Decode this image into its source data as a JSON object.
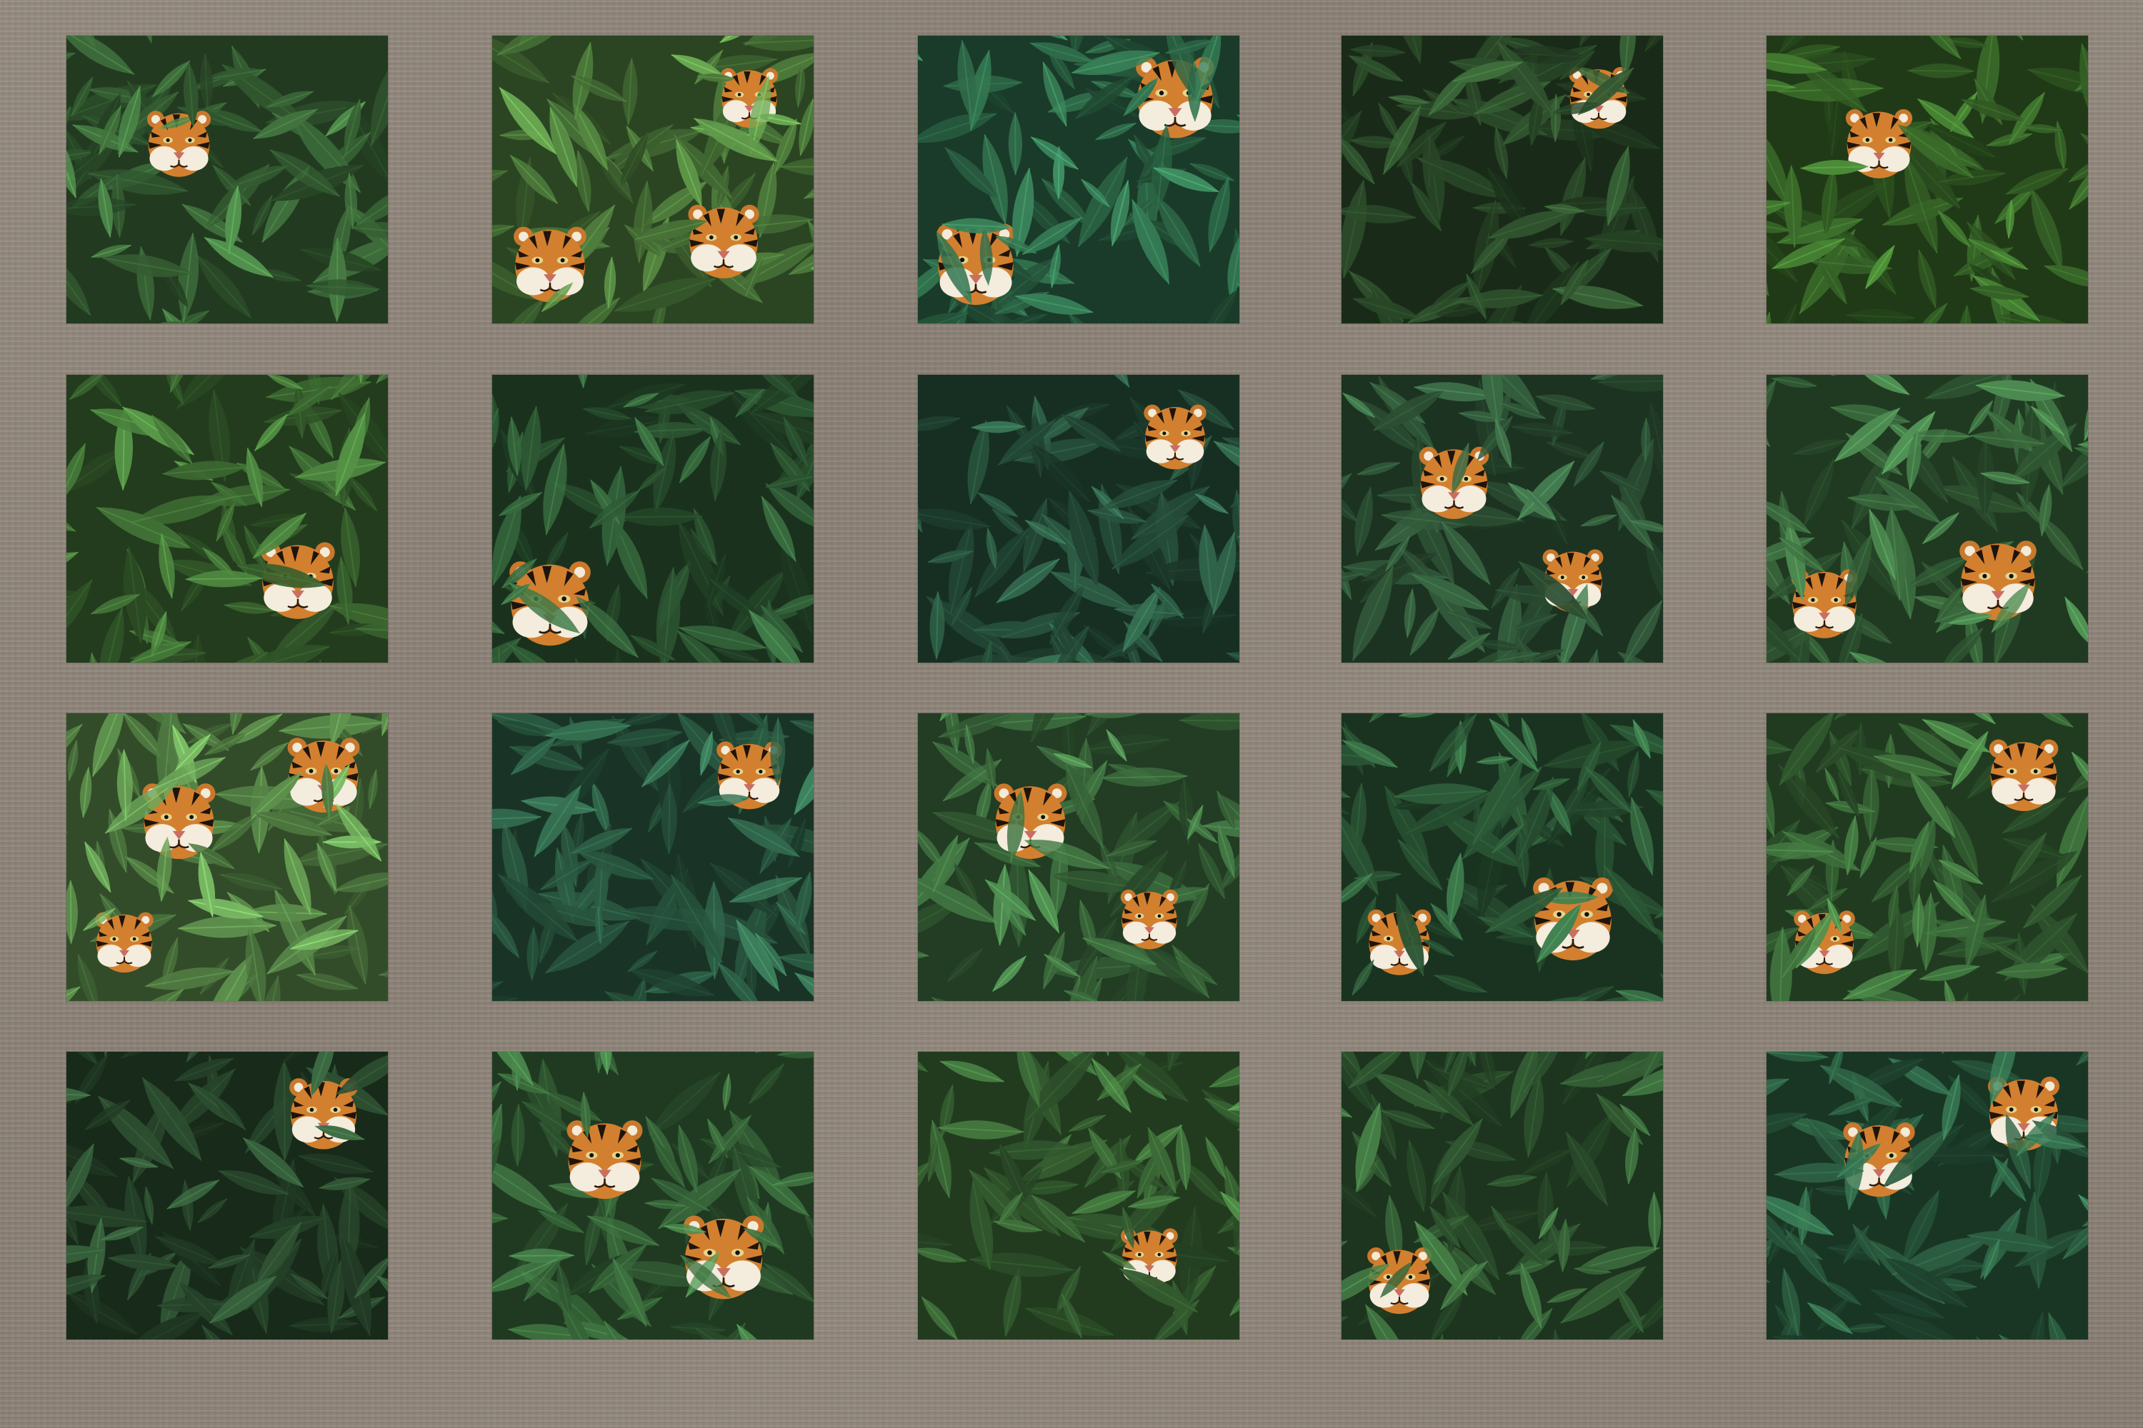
{
  "background": {
    "texture": "linen-fabric",
    "color": "#8c8379"
  },
  "gallery": {
    "tiles": [
      {
        "name": "tile-tigers-1",
        "leaf": "#3d6b3a",
        "tigers": 1
      },
      {
        "name": "tile-tigers-2",
        "leaf": "#4f7d3d",
        "tigers": 3
      },
      {
        "name": "tile-tigers-3",
        "leaf": "#2f6b4a",
        "tigers": 2
      },
      {
        "name": "tile-tigers-4",
        "leaf": "#2e4f2c",
        "tigers": 1
      },
      {
        "name": "tile-tigers-5",
        "leaf": "#3a6a2a",
        "tigers": 1
      },
      {
        "name": "tile-tigers-6",
        "leaf": "#3f6d34",
        "tigers": 1
      },
      {
        "name": "tile-tigers-7",
        "leaf": "#2f5a35",
        "tigers": 1
      },
      {
        "name": "tile-tigers-8",
        "leaf": "#2a5640",
        "tigers": 1
      },
      {
        "name": "tile-tigers-9",
        "leaf": "#335c3c",
        "tigers": 2
      },
      {
        "name": "tile-tigers-10",
        "leaf": "#3b6a3e",
        "tigers": 2
      },
      {
        "name": "tile-tigers-11",
        "leaf": "#5a8a4a",
        "tigers": 3
      },
      {
        "name": "tile-tigers-12",
        "leaf": "#2d5e45",
        "tigers": 1
      },
      {
        "name": "tile-tigers-13",
        "leaf": "#3e6e3f",
        "tigers": 2
      },
      {
        "name": "tile-tigers-14",
        "leaf": "#2f5d3a",
        "tigers": 2
      },
      {
        "name": "tile-tigers-15",
        "leaf": "#3c6c3a",
        "tigers": 2
      },
      {
        "name": "tile-tigers-16",
        "leaf": "#2c4d30",
        "tigers": 1
      },
      {
        "name": "tile-tigers-17",
        "leaf": "#3a6a3c",
        "tigers": 2
      },
      {
        "name": "tile-tigers-18",
        "leaf": "#3d6b38",
        "tigers": 1
      },
      {
        "name": "tile-tigers-19",
        "leaf": "#355f36",
        "tigers": 1
      },
      {
        "name": "tile-tigers-20",
        "leaf": "#2e6244",
        "tigers": 2
      }
    ]
  }
}
